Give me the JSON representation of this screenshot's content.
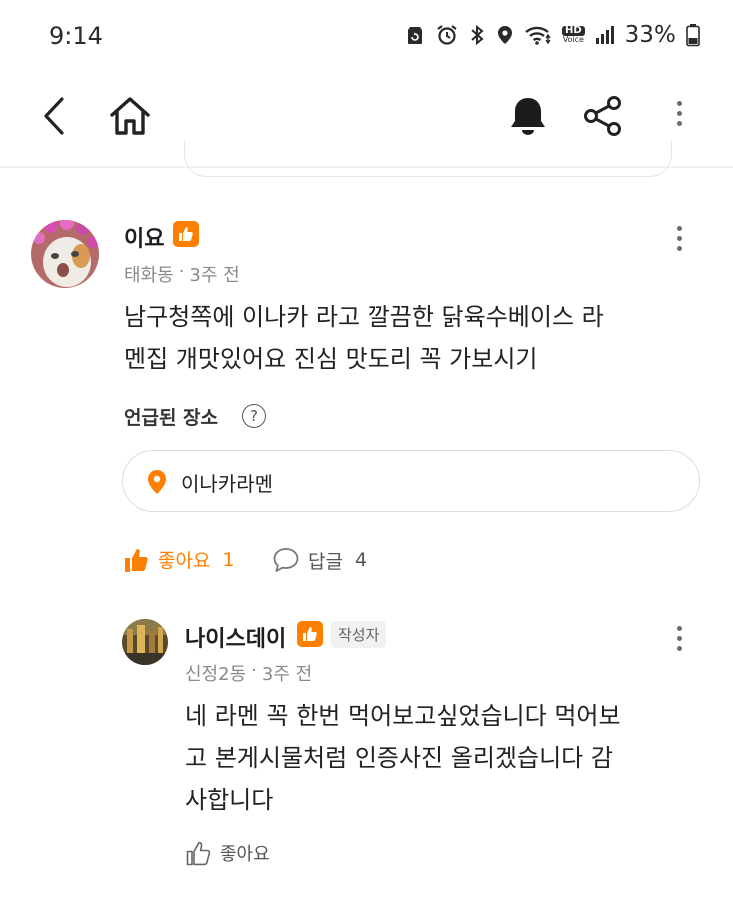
{
  "status_bar": {
    "time": "9:14",
    "battery": "33%",
    "icons": [
      "recycle-icon",
      "alarm-icon",
      "bluetooth-icon",
      "location-icon",
      "wifi-icon",
      "hd-voice-icon",
      "signal-icon",
      "battery-icon"
    ],
    "hd_top": "HD",
    "hd_bottom": "Voice"
  },
  "header": {
    "icons": [
      "back-arrow-icon",
      "home-icon",
      "bell-icon",
      "share-icon",
      "more-vertical-icon"
    ]
  },
  "comment": {
    "author": "이요",
    "location": "태화동",
    "separator": "·",
    "time": "3주 전",
    "text_line1": "남구청쪽에 이나카 라고 깔끔한 닭육수베이스 라",
    "text_line2": "멘집 개맛있어요 진심 맛도리 꼭 가보시기",
    "mentioned_label": "언급된 장소",
    "help": "?",
    "place": "이나카라멘",
    "like_label": "좋아요",
    "like_count": "1",
    "reply_label": "답글",
    "reply_count": "4"
  },
  "reply": {
    "author": "나이스데이",
    "author_tag": "작성자",
    "location": "신정2동",
    "separator": "·",
    "time": "3주 전",
    "text_line1": "네 라멘 꼭 한번 먹어보고싶었습니다 먹어보",
    "text_line2": "고 본게시물처럼 인증사진 올리겠습니다 감",
    "text_line3": "사합니다",
    "like_label": "좋아요"
  },
  "colors": {
    "accent": "#ff7f00",
    "text": "#212121",
    "muted": "#8a8a8a"
  }
}
